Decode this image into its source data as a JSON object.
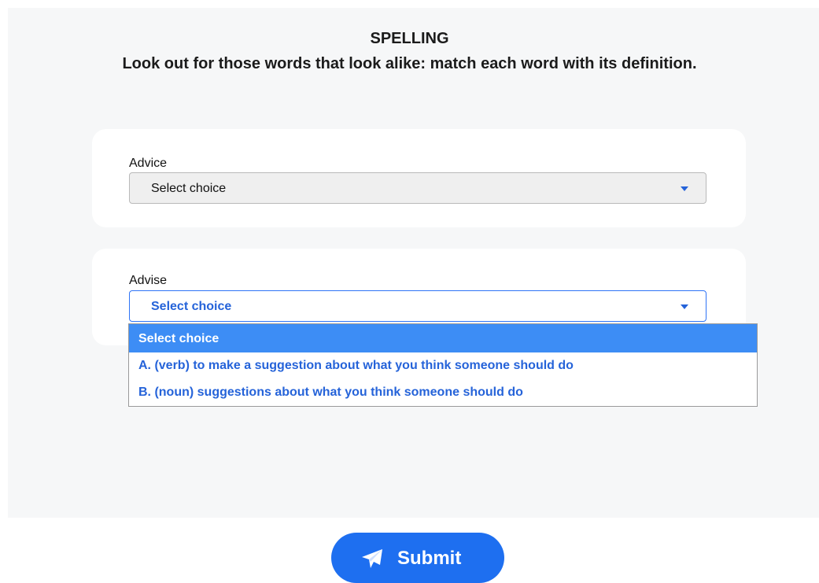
{
  "header": {
    "title": "SPELLING",
    "instruction": "Look out for those words that look alike: match each word with its definition."
  },
  "questions": [
    {
      "word": "Advice",
      "selected": "Select choice"
    },
    {
      "word": "Advise",
      "selected": "Select choice"
    }
  ],
  "dropdown": {
    "options": [
      "Select choice",
      "A. (verb) to make a suggestion about what you think someone should do",
      "B. (noun) suggestions about what you think someone should do"
    ]
  },
  "submit": {
    "label": "Submit",
    "icon": "paper-plane-icon"
  },
  "colors": {
    "accent": "#1e6ff0",
    "option_text": "#2563d9",
    "highlight": "#3d8df5",
    "panel_bg": "#f6f7f8"
  }
}
